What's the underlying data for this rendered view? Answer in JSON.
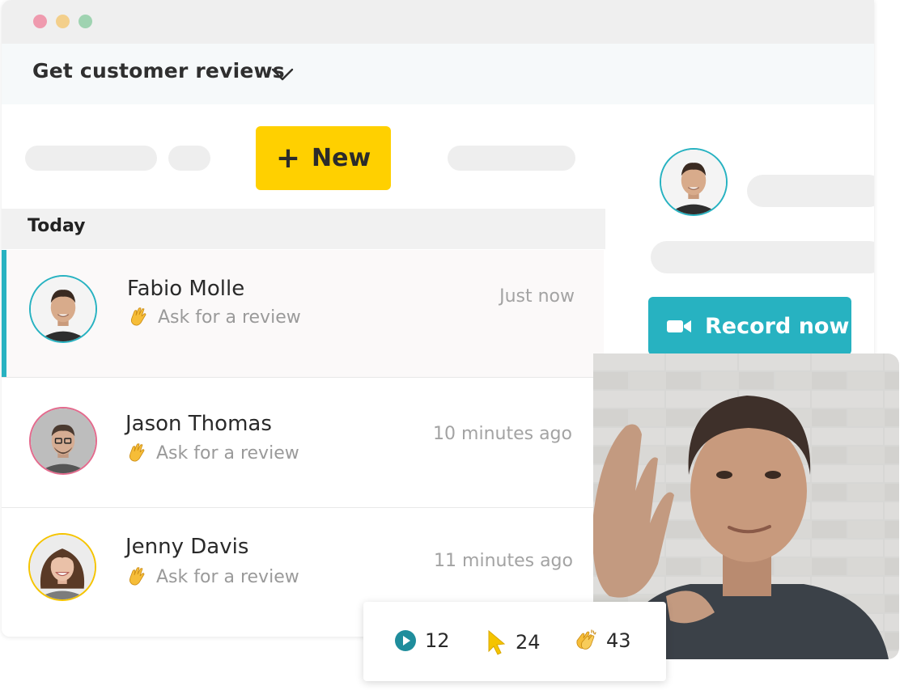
{
  "window": {
    "controls": [
      "close",
      "minimize",
      "maximize"
    ]
  },
  "header": {
    "title": "Get customer reviews",
    "dropdown_icon": "chevron-down-icon"
  },
  "toolbar": {
    "new_label": "New",
    "new_icon": "plus-icon"
  },
  "section": {
    "label": "Today"
  },
  "contacts": [
    {
      "name": "Fabio Molle",
      "action": "Ask for a review",
      "time": "Just now",
      "ring_color": "#27b2c1"
    },
    {
      "name": "Jason Thomas",
      "action": "Ask for a review",
      "time": "10 minutes ago",
      "ring_color": "#e36a8d"
    },
    {
      "name": "Jenny Davis",
      "action": "Ask for a review",
      "time": "11 minutes ago",
      "ring_color": "#f5c400"
    }
  ],
  "detail": {
    "record_label": "Record now",
    "record_icon": "video-camera-icon"
  },
  "stats": {
    "plays": "12",
    "clicks": "24",
    "claps": "43"
  },
  "colors": {
    "accent": "#27b2c1",
    "primary_button": "#ffd000"
  }
}
